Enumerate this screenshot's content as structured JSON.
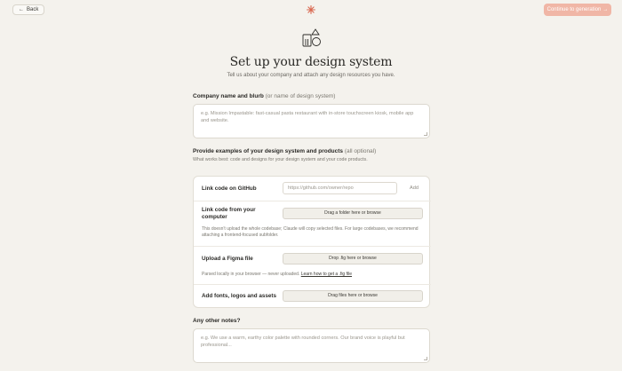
{
  "header": {
    "back_label": "Back",
    "continue_label": "Continue to generation",
    "accent": "#e0735a"
  },
  "hero": {
    "title": "Set up your design system",
    "subtitle": "Tell us about your company and attach any design resources you have."
  },
  "company": {
    "label": "Company name and blurb",
    "label_note": "(or name of design system)",
    "placeholder": "e.g. Mission Impastable: fast-casual pasta restaurant with in-store touchscreen kiosk, mobile app and website."
  },
  "examples": {
    "label": "Provide examples of your design system and products",
    "label_note": "(all optional)",
    "help": "What works best: code and designs for your design system and your code products."
  },
  "resources": {
    "github": {
      "title": "Link code on GitHub",
      "placeholder": "https://github.com/owner/repo",
      "add_label": "Add"
    },
    "computer": {
      "title": "Link code from your computer",
      "drop_label": "Drag a folder here or browse",
      "help": "This doesn't upload the whole codebase; Claude will copy selected files. For large codebases, we recommend attaching a frontend-focused subfolder."
    },
    "figma": {
      "title": "Upload a Figma file",
      "drop_label": "Drop .fig here or browse",
      "help": "Parsed locally in your browser — never uploaded.",
      "link": "Learn how to get a .fig file"
    },
    "assets": {
      "title": "Add fonts, logos and assets",
      "drop_label": "Drag files here or browse"
    }
  },
  "notes": {
    "label": "Any other notes?",
    "placeholder": "e.g. We use a warm, earthy color palette with rounded corners. Our brand voice is playful but professional..."
  }
}
